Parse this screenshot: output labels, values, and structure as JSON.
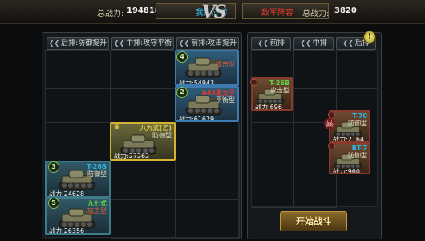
{
  "header": {
    "my_power_label": "总战力:",
    "my_power_value": "194818",
    "my_team_label": "我的阵容",
    "vs_text": "VS",
    "enemy_team_label": "敌军阵容",
    "enemy_power_label": "总战力:",
    "enemy_power_value": "3820"
  },
  "my_formation": {
    "tabs": [
      "后排:防御提升",
      "中排:攻守平衡",
      "前排:攻击提升"
    ],
    "units": [
      {
        "name": "",
        "role": "攻击型",
        "power": "战力:54943",
        "badge": "4"
      },
      {
        "name": "A43黑太子",
        "role": "平衡型",
        "power": "战力:61629",
        "badge": "2"
      },
      {
        "name": "八九式(乙)",
        "role": "防御型",
        "power": "战力:27262"
      },
      {
        "name": "T-26B",
        "role": "防御型",
        "power": "战力:24628",
        "badge": "3"
      },
      {
        "name": "九七式",
        "role": "攻击型",
        "power": "战力:26356",
        "badge": "5"
      }
    ]
  },
  "enemy_formation": {
    "tabs": [
      "前排",
      "中排",
      "后排"
    ],
    "units": [
      {
        "name": "T-26B",
        "role": "攻击型",
        "power": "战力:696"
      },
      {
        "name": "T-70",
        "role": "防御型",
        "power": "战力:2164"
      },
      {
        "name": "BT-7",
        "role": "防御型",
        "power": "战力:960"
      }
    ]
  },
  "actions": {
    "start_battle_label": "开始战斗",
    "help_label": "!"
  },
  "colors": {
    "accent_gold": "#d6b233",
    "my_team": "#2fb6e6",
    "enemy_team": "#e23a2a"
  },
  "icons": [
    "crown-icon",
    "skull-icon",
    "help-icon",
    "chevron-icon",
    "tank-icon"
  ]
}
